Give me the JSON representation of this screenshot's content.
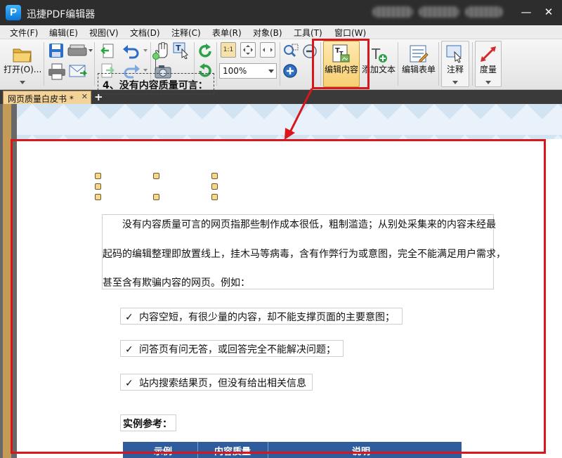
{
  "window": {
    "title": "迅捷PDF编辑器",
    "logo_letter": "P",
    "controls": {
      "minimize": "—",
      "close": "✕"
    }
  },
  "menu": [
    "文件(F)",
    "编辑(E)",
    "视图(V)",
    "文档(D)",
    "注释(C)",
    "表单(R)",
    "对象(B)",
    "工具(T)",
    "窗口(W)"
  ],
  "toolbar": {
    "open_label": "打开(O)...",
    "zoom_value": "100%",
    "edit_content_label": "编辑内容",
    "add_text_label": "添加文本",
    "edit_form_label": "编辑表单",
    "annotate_label": "注释",
    "measure_label": "度量",
    "page_view_1": "1:1"
  },
  "tabs": [
    {
      "label": "网页质量白皮书 *"
    }
  ],
  "document": {
    "heading": "4、没有内容质量可言：",
    "paragraph_lines": [
      "没有内容质量可言的网页指那些制作成本很低，粗制滥造；从别处采集来的内容未经最",
      "起码的编辑整理即放置线上，挂木马等病毒，含有作弊行为或意图，完全不能满足用户需求，",
      "甚至含有欺骗内容的网页。例如："
    ],
    "bullets": [
      "内容空短，有很少量的内容，却不能支撑页面的主要意图；",
      "问答页有问无答，或回答完全不能解决问题；",
      "站内搜索结果页，但没有给出相关信息"
    ],
    "check_mark": "✓",
    "example_title": "实例参考：",
    "table_headers": [
      "示例",
      "内容质量",
      "说明"
    ]
  },
  "colors": {
    "highlight": "#d8161c",
    "table_header": "#2f5c9c",
    "tab_active": "#f3d398"
  }
}
